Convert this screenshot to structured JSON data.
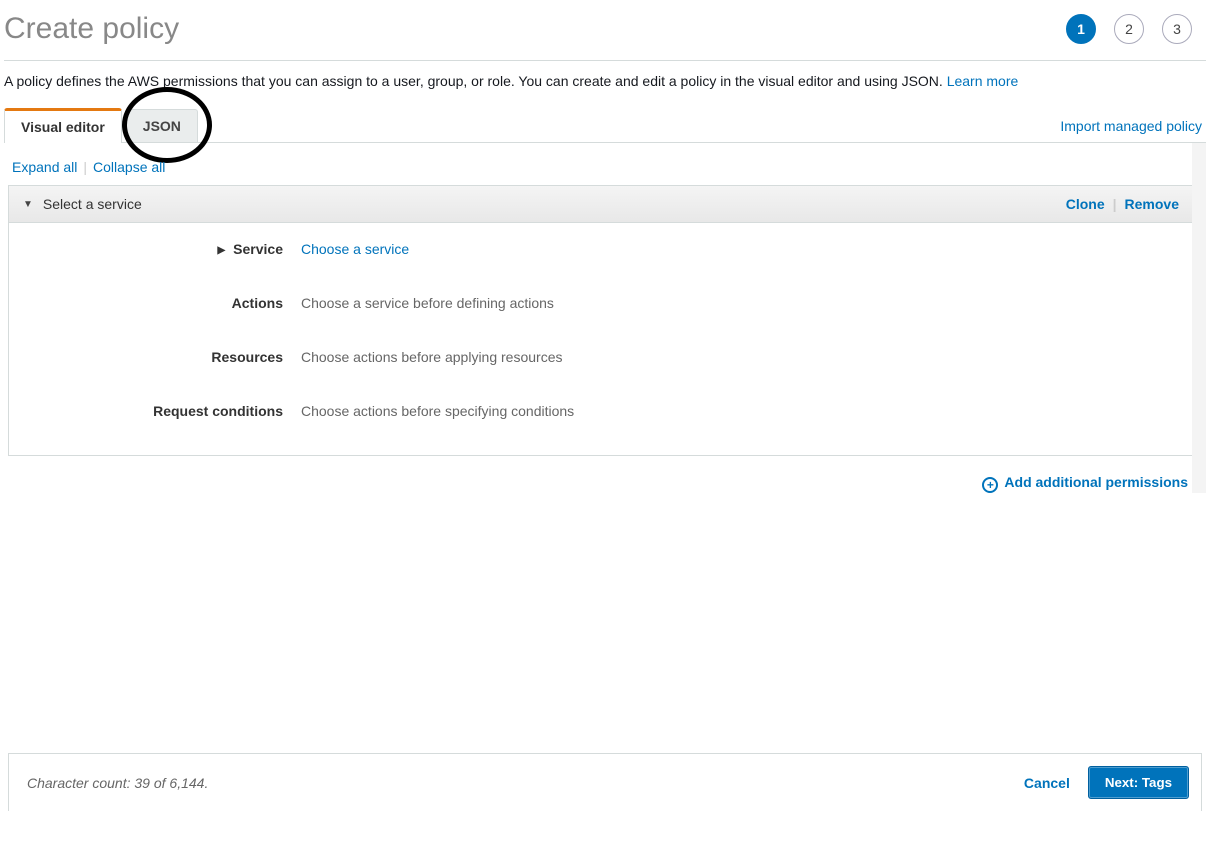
{
  "header": {
    "title": "Create policy",
    "steps": [
      {
        "num": "1",
        "active": true
      },
      {
        "num": "2",
        "active": false
      },
      {
        "num": "3",
        "active": false
      }
    ]
  },
  "description": {
    "text": "A policy defines the AWS permissions that you can assign to a user, group, or role. You can create and edit a policy in the visual editor and using JSON. ",
    "learn_more": "Learn more"
  },
  "tabs": {
    "visual_editor": "Visual editor",
    "json": "JSON",
    "import_link": "Import managed policy"
  },
  "expand": {
    "expand_all": "Expand all",
    "collapse_all": "Collapse all"
  },
  "panel": {
    "title": "Select a service",
    "clone": "Clone",
    "remove": "Remove",
    "rows": {
      "service_label": "Service",
      "service_value": "Choose a service",
      "actions_label": "Actions",
      "actions_value": "Choose a service before defining actions",
      "resources_label": "Resources",
      "resources_value": "Choose actions before applying resources",
      "conditions_label": "Request conditions",
      "conditions_value": "Choose actions before specifying conditions"
    }
  },
  "add_permissions": "Add additional permissions",
  "footer": {
    "char_count": "Character count: 39 of 6,144.",
    "cancel": "Cancel",
    "next": "Next: Tags"
  }
}
